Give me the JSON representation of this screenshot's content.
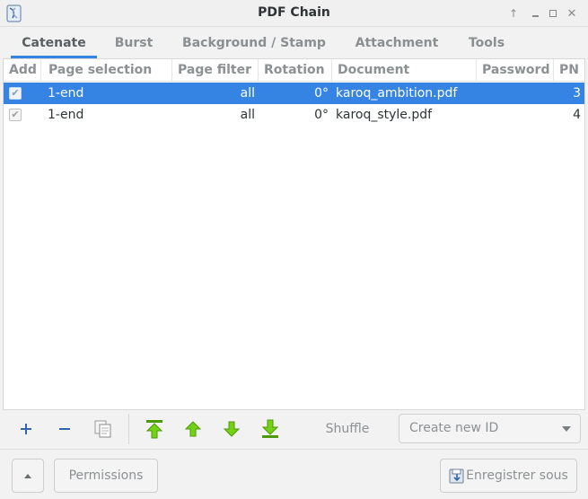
{
  "window": {
    "title": "PDF Chain"
  },
  "tabs": [
    {
      "label": "Catenate",
      "active": true
    },
    {
      "label": "Burst",
      "active": false
    },
    {
      "label": "Background / Stamp",
      "active": false
    },
    {
      "label": "Attachment",
      "active": false
    },
    {
      "label": "Tools",
      "active": false
    }
  ],
  "table": {
    "headers": [
      "Add",
      "Page selection",
      "Page filter",
      "Rotation",
      "Document",
      "Password",
      "PN"
    ],
    "rows": [
      {
        "add": true,
        "page_selection": "1-end",
        "page_filter": "all",
        "rotation": "0°",
        "document": "karoq_ambition.pdf",
        "password": "",
        "pn": "3",
        "selected": true
      },
      {
        "add": true,
        "page_selection": "1-end",
        "page_filter": "all",
        "rotation": "0°",
        "document": "karoq_style.pdf",
        "password": "",
        "pn": "4",
        "selected": false
      }
    ]
  },
  "toolbar": {
    "add_icon": "plus-icon",
    "remove_icon": "minus-icon",
    "copy_icon": "copy-icon",
    "move_top_icon": "move-top-icon",
    "move_up_icon": "move-up-icon",
    "move_down_icon": "move-down-icon",
    "move_bottom_icon": "move-bottom-icon",
    "shuffle_label": "Shuffle",
    "id_combo_value": "Create new ID"
  },
  "bottom": {
    "permissions_label": "Permissions",
    "save_as_label": "Enregistrer sous"
  },
  "colors": {
    "accent": "#3584e4",
    "arrow_green": "#4e9a06",
    "plus_blue": "#3465a4"
  }
}
